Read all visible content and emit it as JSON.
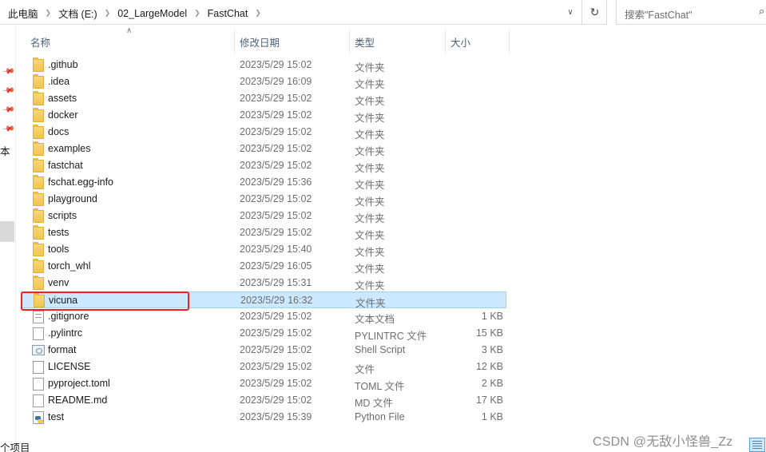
{
  "address_bar": {
    "breadcrumbs": [
      "此电脑",
      "文档 (E:)",
      "02_LargeModel",
      "FastChat"
    ],
    "separator_icon": "chevron-right-icon",
    "dropdown_icon": "chevron-down-icon",
    "refresh_icon": "refresh-icon"
  },
  "search": {
    "placeholder": "搜索\"FastChat\"",
    "icon": "search-icon"
  },
  "nav": {
    "pins": [
      "pin-icon",
      "pin-icon",
      "pin-icon",
      "pin-icon"
    ],
    "partial_label": "本",
    "status_text": "个项目"
  },
  "columns": {
    "name": "名称",
    "date": "修改日期",
    "type": "类型",
    "size": "大小",
    "sort_icon": "sort-ascending-icon"
  },
  "files": [
    {
      "name": ".github",
      "date": "2023/5/29 15:02",
      "type": "文件夹",
      "size": "",
      "icon": "folder"
    },
    {
      "name": ".idea",
      "date": "2023/5/29 16:09",
      "type": "文件夹",
      "size": "",
      "icon": "folder"
    },
    {
      "name": "assets",
      "date": "2023/5/29 15:02",
      "type": "文件夹",
      "size": "",
      "icon": "folder"
    },
    {
      "name": "docker",
      "date": "2023/5/29 15:02",
      "type": "文件夹",
      "size": "",
      "icon": "folder"
    },
    {
      "name": "docs",
      "date": "2023/5/29 15:02",
      "type": "文件夹",
      "size": "",
      "icon": "folder"
    },
    {
      "name": "examples",
      "date": "2023/5/29 15:02",
      "type": "文件夹",
      "size": "",
      "icon": "folder"
    },
    {
      "name": "fastchat",
      "date": "2023/5/29 15:02",
      "type": "文件夹",
      "size": "",
      "icon": "folder"
    },
    {
      "name": "fschat.egg-info",
      "date": "2023/5/29 15:36",
      "type": "文件夹",
      "size": "",
      "icon": "folder"
    },
    {
      "name": "playground",
      "date": "2023/5/29 15:02",
      "type": "文件夹",
      "size": "",
      "icon": "folder"
    },
    {
      "name": "scripts",
      "date": "2023/5/29 15:02",
      "type": "文件夹",
      "size": "",
      "icon": "folder"
    },
    {
      "name": "tests",
      "date": "2023/5/29 15:02",
      "type": "文件夹",
      "size": "",
      "icon": "folder"
    },
    {
      "name": "tools",
      "date": "2023/5/29 15:40",
      "type": "文件夹",
      "size": "",
      "icon": "folder"
    },
    {
      "name": "torch_whl",
      "date": "2023/5/29 16:05",
      "type": "文件夹",
      "size": "",
      "icon": "folder"
    },
    {
      "name": "venv",
      "date": "2023/5/29 15:31",
      "type": "文件夹",
      "size": "",
      "icon": "folder"
    },
    {
      "name": "vicuna",
      "date": "2023/5/29 16:32",
      "type": "文件夹",
      "size": "",
      "icon": "folder",
      "selected": true
    },
    {
      "name": ".gitignore",
      "date": "2023/5/29 15:02",
      "type": "文本文档",
      "size": "1 KB",
      "icon": "text-document"
    },
    {
      "name": ".pylintrc",
      "date": "2023/5/29 15:02",
      "type": "PYLINTRC 文件",
      "size": "15 KB",
      "icon": "file"
    },
    {
      "name": "format",
      "date": "2023/5/29 15:02",
      "type": "Shell Script",
      "size": "3 KB",
      "icon": "shell-script"
    },
    {
      "name": "LICENSE",
      "date": "2023/5/29 15:02",
      "type": "文件",
      "size": "12 KB",
      "icon": "file"
    },
    {
      "name": "pyproject.toml",
      "date": "2023/5/29 15:02",
      "type": "TOML 文件",
      "size": "2 KB",
      "icon": "file"
    },
    {
      "name": "README.md",
      "date": "2023/5/29 15:02",
      "type": "MD 文件",
      "size": "17 KB",
      "icon": "file"
    },
    {
      "name": "test",
      "date": "2023/5/29 15:39",
      "type": "Python File",
      "size": "1 KB",
      "icon": "python-file"
    }
  ],
  "highlight": {
    "target": "vicuna",
    "color": "#f2201e"
  },
  "watermark": "CSDN @无敌小怪兽_Zz",
  "colors": {
    "selection_bg": "#cce8ff",
    "selection_border": "#99d1ff",
    "header_text": "#4c607a"
  }
}
